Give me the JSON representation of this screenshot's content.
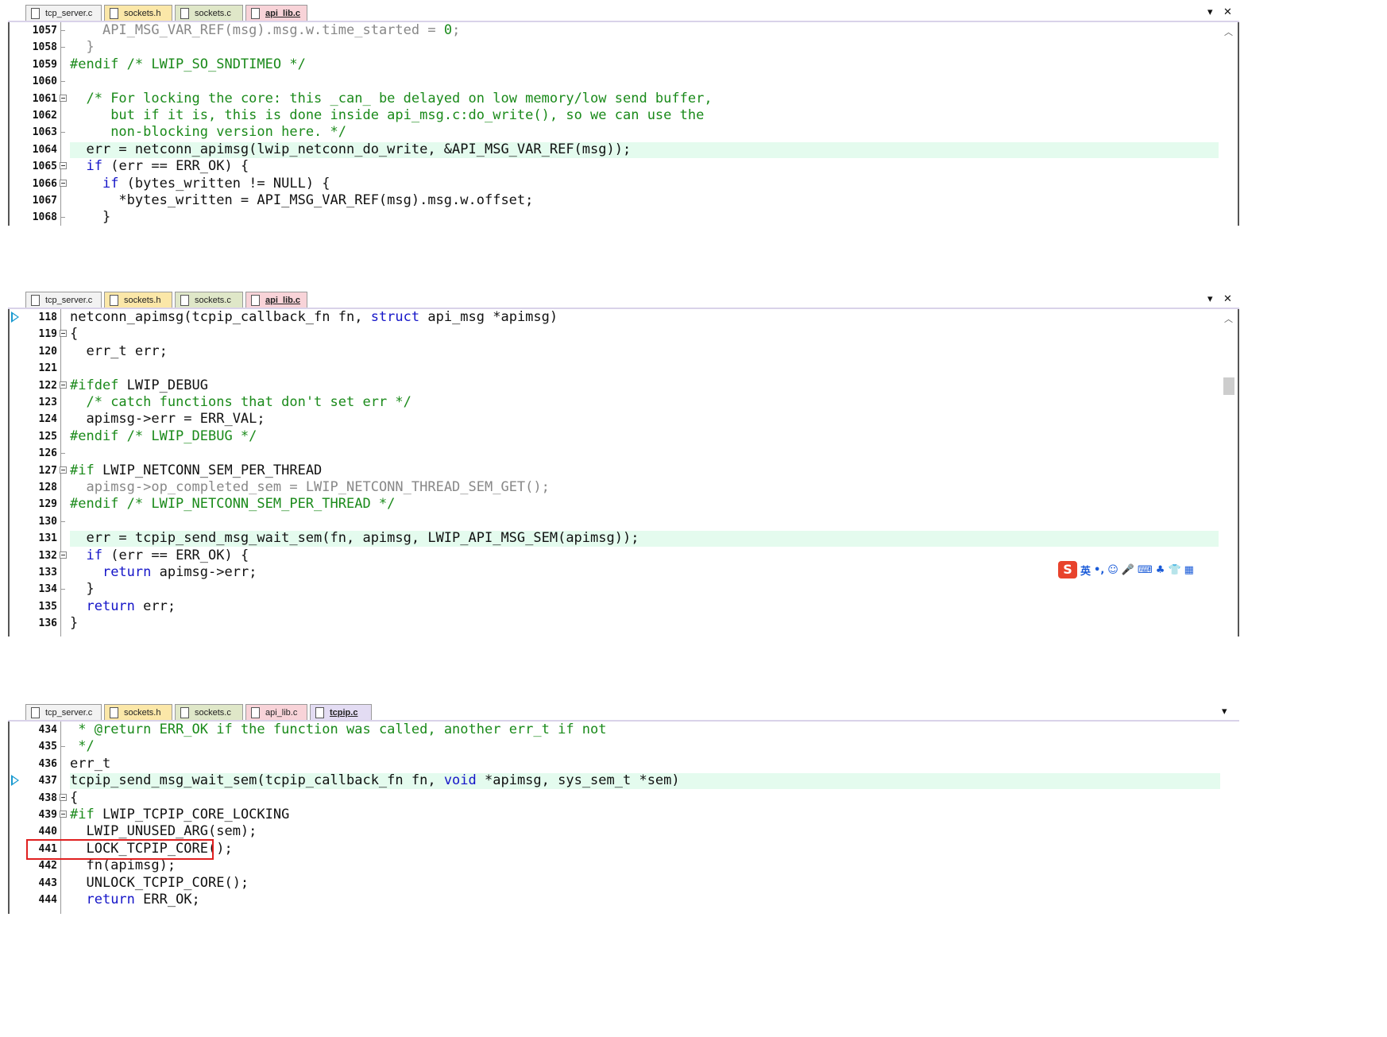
{
  "pane1": {
    "tabs": [
      {
        "label": "tcp_server.c",
        "color": "#f2f2f2",
        "active": false
      },
      {
        "label": "sockets.h",
        "color": "#fbe7a8",
        "active": false
      },
      {
        "label": "sockets.c",
        "color": "#dfe7c8",
        "active": false
      },
      {
        "label": "api_lib.c",
        "color": "#f8d3d8",
        "active": true
      }
    ],
    "controls": {
      "dropdown": "▾",
      "close": "✕"
    },
    "lines": [
      {
        "n": "1057",
        "html": "    <span class='gr'>API_MSG_VAR_REF(msg).msg.w.time_started = <span class='num'>0</span>;</span>",
        "mark": "tick"
      },
      {
        "n": "1058",
        "html": "  <span class='gr'>}</span>",
        "mark": "tick"
      },
      {
        "n": "1059",
        "html": "<span class='pp'>#endif /* LWIP_SO_SNDTIMEO */</span>",
        "mark": ""
      },
      {
        "n": "1060",
        "html": "",
        "mark": "tick"
      },
      {
        "n": "1061",
        "html": "  <span class='cm'>/* For locking the core: this _can_ be delayed on low memory/low send buffer,</span>",
        "mark": "fold"
      },
      {
        "n": "1062",
        "html": "     <span class='cm'>but if it is, this is done inside api_msg.c:do_write(), so we can use the</span>",
        "mark": ""
      },
      {
        "n": "1063",
        "html": "     <span class='cm'>non-blocking version here. */</span>",
        "mark": "tick"
      },
      {
        "n": "1064",
        "html": "  err = netconn_apimsg(lwip_netconn_do_write, &amp;API_MSG_VAR_REF(msg));",
        "mark": "",
        "hl": true
      },
      {
        "n": "1065",
        "html": "  <span class='kw'>if</span> (err == ERR_OK) {",
        "mark": "fold"
      },
      {
        "n": "1066",
        "html": "    <span class='kw'>if</span> (bytes_written != NULL) {",
        "mark": "fold"
      },
      {
        "n": "1067",
        "html": "      *bytes_written = API_MSG_VAR_REF(msg).msg.w.offset;",
        "mark": ""
      },
      {
        "n": "1068",
        "html": "    }",
        "mark": "tick"
      }
    ]
  },
  "pane2": {
    "tabs": [
      {
        "label": "tcp_server.c",
        "color": "#f2f2f2",
        "active": false
      },
      {
        "label": "sockets.h",
        "color": "#fbe7a8",
        "active": false
      },
      {
        "label": "sockets.c",
        "color": "#dfe7c8",
        "active": false
      },
      {
        "label": "api_lib.c",
        "color": "#f8d3d8",
        "active": true
      }
    ],
    "controls": {
      "dropdown": "▾",
      "close": "✕"
    },
    "lines": [
      {
        "n": "118",
        "html": "netconn_apimsg(tcpip_callback_fn fn, <span class='kw'>struct</span> api_msg *apimsg)",
        "mark": "",
        "bp": true
      },
      {
        "n": "119",
        "html": "{",
        "mark": "fold"
      },
      {
        "n": "120",
        "html": "  err_t err;",
        "mark": ""
      },
      {
        "n": "121",
        "html": "",
        "mark": ""
      },
      {
        "n": "122",
        "html": "<span class='pp'>#ifdef</span> LWIP_DEBUG",
        "mark": "fold"
      },
      {
        "n": "123",
        "html": "  <span class='cm'>/* catch functions that don't set err */</span>",
        "mark": ""
      },
      {
        "n": "124",
        "html": "  apimsg-&gt;err = ERR_VAL;",
        "mark": ""
      },
      {
        "n": "125",
        "html": "<span class='pp'>#endif /* LWIP_DEBUG */</span>",
        "mark": ""
      },
      {
        "n": "126",
        "html": "",
        "mark": "tick"
      },
      {
        "n": "127",
        "html": "<span class='pp'>#if</span> LWIP_NETCONN_SEM_PER_THREAD",
        "mark": "fold"
      },
      {
        "n": "128",
        "html": "  <span class='gr'>apimsg-&gt;op_completed_sem = LWIP_NETCONN_THREAD_SEM_GET();</span>",
        "mark": ""
      },
      {
        "n": "129",
        "html": "<span class='pp'>#endif /* LWIP_NETCONN_SEM_PER_THREAD */</span>",
        "mark": ""
      },
      {
        "n": "130",
        "html": "",
        "mark": "tick"
      },
      {
        "n": "131",
        "html": "  err = tcpip_send_msg_wait_sem(fn, apimsg, LWIP_API_MSG_SEM(apimsg));",
        "mark": "",
        "hl": true
      },
      {
        "n": "132",
        "html": "  <span class='kw'>if</span> (err == ERR_OK) {",
        "mark": "fold"
      },
      {
        "n": "133",
        "html": "    <span class='kw'>return</span> apimsg-&gt;err;",
        "mark": ""
      },
      {
        "n": "134",
        "html": "  }",
        "mark": "tick"
      },
      {
        "n": "135",
        "html": "  <span class='kw'>return</span> err;",
        "mark": ""
      },
      {
        "n": "136",
        "html": "}",
        "mark": ""
      }
    ],
    "ime": {
      "logo": "S",
      "items": [
        "英",
        "•,",
        "☺",
        "🎤",
        "⌨",
        "♣",
        "👕",
        "▦"
      ]
    }
  },
  "pane3": {
    "tabs": [
      {
        "label": "tcp_server.c",
        "color": "#f2f2f2",
        "active": false
      },
      {
        "label": "sockets.h",
        "color": "#fbe7a8",
        "active": false
      },
      {
        "label": "sockets.c",
        "color": "#dfe7c8",
        "active": false
      },
      {
        "label": "api_lib.c",
        "color": "#f8d3d8",
        "active": false
      },
      {
        "label": "tcpip.c",
        "color": "#e3dcf3",
        "active": true
      }
    ],
    "controls": {
      "dropdown": "▾",
      "close": "✕"
    },
    "lines": [
      {
        "n": "434",
        "html": " <span class='cm'>* @return ERR_OK if the function was called, another err_t if not</span>",
        "mark": ""
      },
      {
        "n": "435",
        "html": " <span class='cm'>*/</span>",
        "mark": "tick"
      },
      {
        "n": "436",
        "html": "err_t",
        "mark": ""
      },
      {
        "n": "437",
        "html": "tcpip_send_msg_wait_sem(tcpip_callback_fn fn, <span class='kw'>void</span> *apimsg, sys_sem_t *sem)",
        "mark": "",
        "hl": true,
        "bp": true
      },
      {
        "n": "438",
        "html": "{",
        "mark": "fold"
      },
      {
        "n": "439",
        "html": "<span class='pp'>#if</span> LWIP_TCPIP_CORE_LOCKING",
        "mark": "fold"
      },
      {
        "n": "440",
        "html": "  LWIP_UNUSED_ARG(sem);",
        "mark": ""
      },
      {
        "n": "441",
        "html": "  LOCK_TCPIP_CORE();",
        "mark": ""
      },
      {
        "n": "442",
        "html": "  fn(apimsg);",
        "mark": ""
      },
      {
        "n": "443",
        "html": "  UNLOCK_TCPIP_CORE();",
        "mark": ""
      },
      {
        "n": "444",
        "html": "  <span class='kw'>return</span> ERR_OK;",
        "mark": ""
      }
    ]
  }
}
